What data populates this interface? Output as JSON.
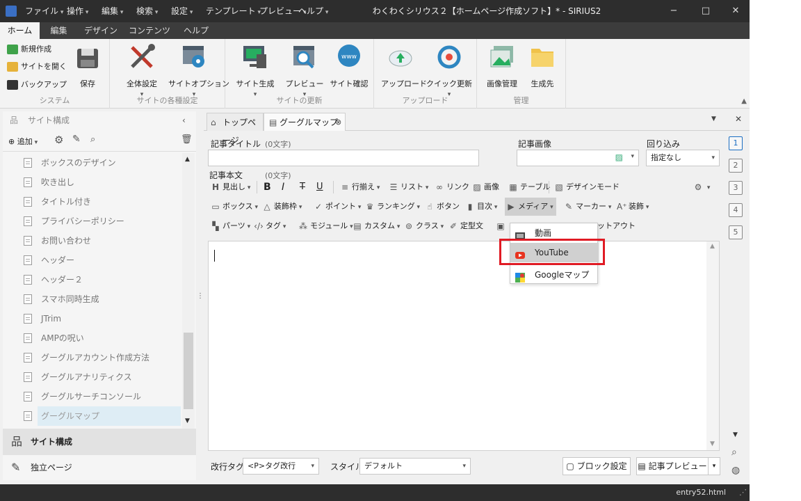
{
  "titlebar": {
    "menus": [
      "ファイル",
      "操作",
      "編集",
      "検索",
      "設定",
      "テンプレート",
      "プレビュー",
      "ヘルプ"
    ],
    "title": "わくわくシリウス２【ホームページ作成ソフト】* - SIRIUS2",
    "minimize": "−",
    "maximize": "□",
    "close": "✕"
  },
  "ribbon_tabs": [
    "ホーム",
    "編集",
    "デザイン",
    "コンテンツ",
    "ヘルプ"
  ],
  "ribbon": {
    "system": {
      "label": "システム",
      "new_site": "新規作成",
      "open_site": "サイトを開く",
      "backup": "バックアップ",
      "save": "保存"
    },
    "site_settings": {
      "label": "サイトの各種設定",
      "global": "全体設定",
      "options": "サイトオプション"
    },
    "site_update": {
      "label": "サイトの更新",
      "generate": "サイト生成",
      "preview": "プレビュー",
      "check": "サイト確認",
      "www": "www"
    },
    "upload": {
      "label": "アップロード",
      "upload": "アップロード",
      "quick": "クイック更新"
    },
    "manage": {
      "label": "管理",
      "images": "画像管理",
      "output": "生成先"
    }
  },
  "left_pane": {
    "header": "サイト構成",
    "add": "追加",
    "tree": [
      "ボックスのデザイン",
      "吹き出し",
      "タイトル付き",
      "プライバシーポリシー",
      "お問い合わせ",
      "ヘッダー",
      "ヘッダー２",
      "スマホ同時生成",
      "JTrim",
      "AMPの呪い",
      "グーグルアカウント作成方法",
      "グーグルアナリティクス",
      "グーグルサーチコンソール",
      "グーグルマップ"
    ],
    "nav_site": "サイト構成",
    "nav_pages": "独立ページ"
  },
  "doc_tabs": {
    "top": "トップページ",
    "current": "グーグルマップ"
  },
  "form": {
    "title_label": "記事タイトル",
    "title_count": "(0文字)",
    "image_label": "記事画像",
    "wrap_label": "回り込み",
    "wrap_value": "指定なし",
    "body_label": "記事本文",
    "body_count": "(0文字)"
  },
  "toolbar": {
    "row1": [
      "見出し",
      "B",
      "I",
      "T",
      "U",
      "行揃え",
      "リスト",
      "リンク",
      "画像",
      "テーブル",
      "デザインモード"
    ],
    "row2": [
      "ボックス",
      "装飾枠",
      "ポイント",
      "ランキング",
      "ボタン",
      "目次",
      "メディア",
      "マーカー",
      "装飾"
    ],
    "row3": [
      "パーツ",
      "タグ",
      "モジュール",
      "カスタム",
      "クラス",
      "定型文",
      "ットアウト"
    ]
  },
  "media_menu": [
    "動画",
    "YouTube",
    "Googleマップ"
  ],
  "bottom": {
    "newline_label": "改行タグ",
    "newline_value": "<P>タグ改行",
    "style_label": "スタイル",
    "style_value": "デフォルト",
    "block_settings": "ブロック設定",
    "article_preview": "記事プレビュー"
  },
  "right_tabs": [
    "1",
    "2",
    "3",
    "4",
    "5"
  ],
  "status": {
    "file": "entry52.html"
  },
  "colors": {
    "accent": "#1b6ec2",
    "highlight": "#e01b24",
    "dark": "#2d2d2d"
  }
}
